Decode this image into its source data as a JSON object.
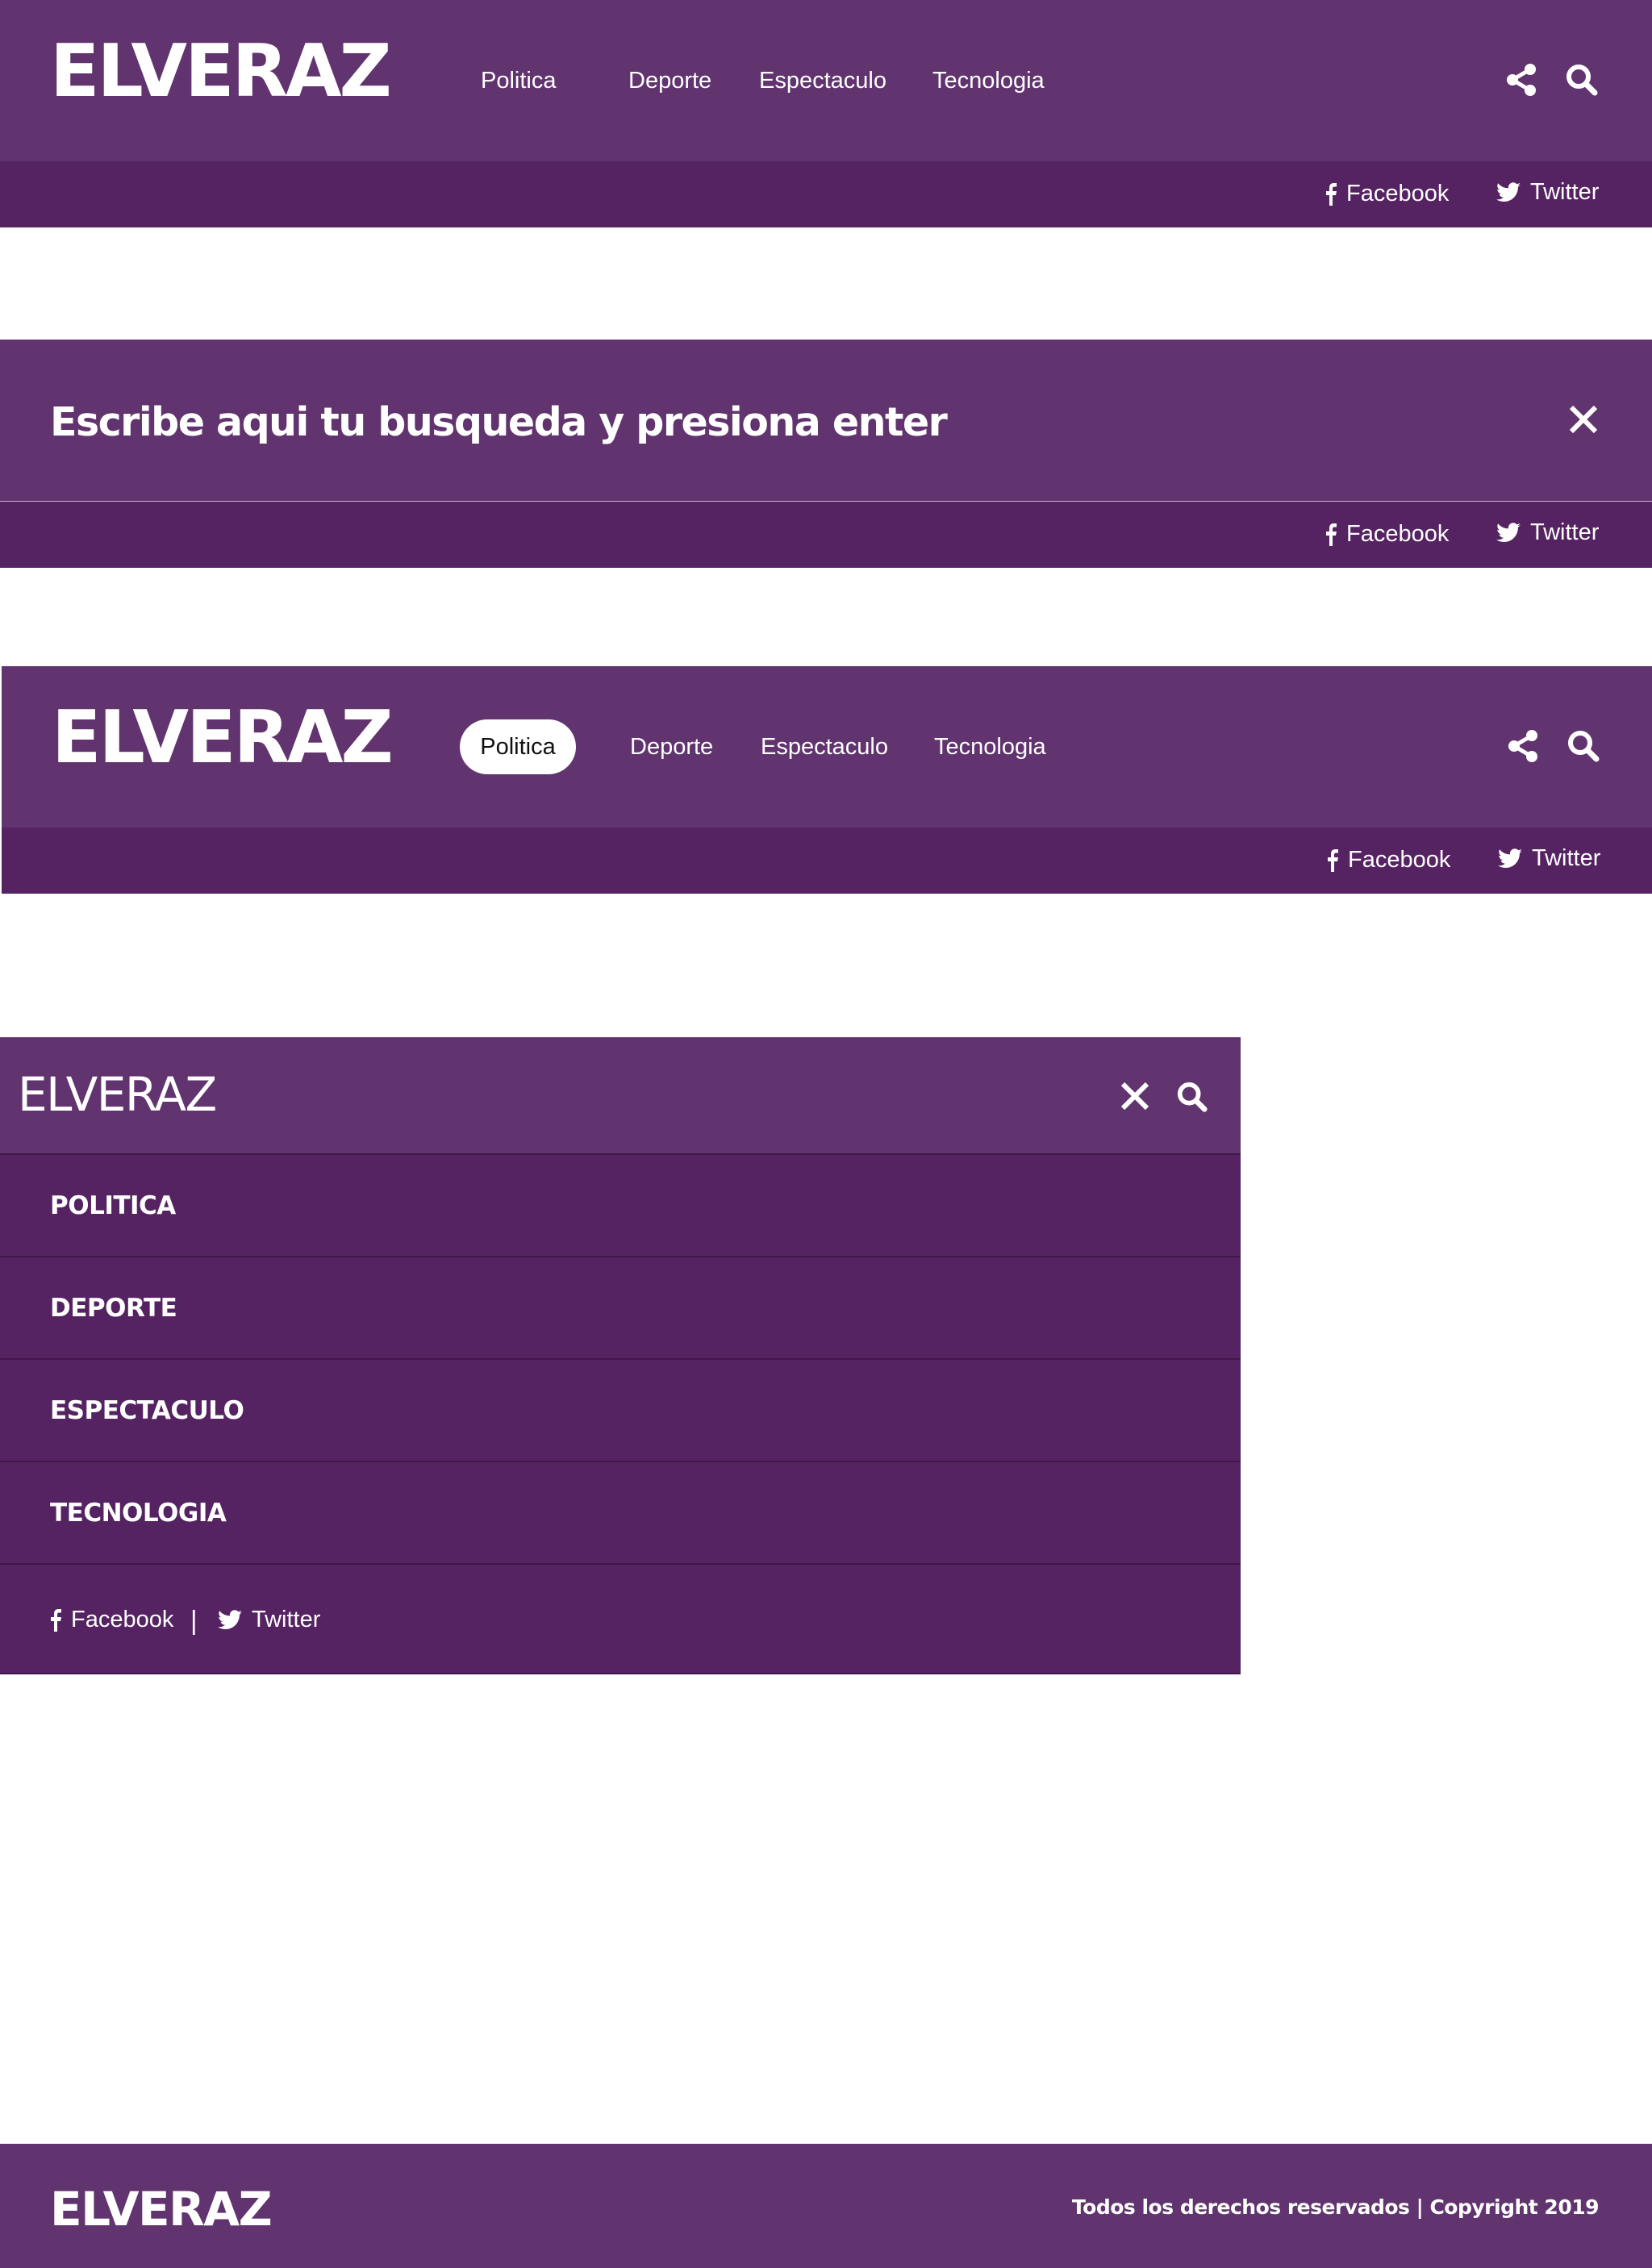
{
  "brand": {
    "name": "ELVERAZ"
  },
  "nav": {
    "items": [
      "Politica",
      "Deporte",
      "Espectaculo",
      "Tecnologia"
    ]
  },
  "social": {
    "facebook": "Facebook",
    "twitter": "Twitter",
    "separator": "|"
  },
  "search_overlay": {
    "prompt": "Escribe aqui tu busqueda y presiona enter"
  },
  "mobile_menu": {
    "items": [
      "POLITICA",
      "DEPORTE",
      "ESPECTACULO",
      "TECNOLOGIA"
    ]
  },
  "footer": {
    "rights": "Todos los derechos reservados",
    "copyright": "| Copyright 2019"
  },
  "icons": {
    "share": "share-icon",
    "search": "search-icon",
    "close": "close-icon",
    "facebook": "facebook-icon",
    "twitter": "twitter-icon"
  },
  "colors": {
    "header": "#61346f",
    "subbar": "#552362",
    "active_pill": "#ffffff"
  }
}
